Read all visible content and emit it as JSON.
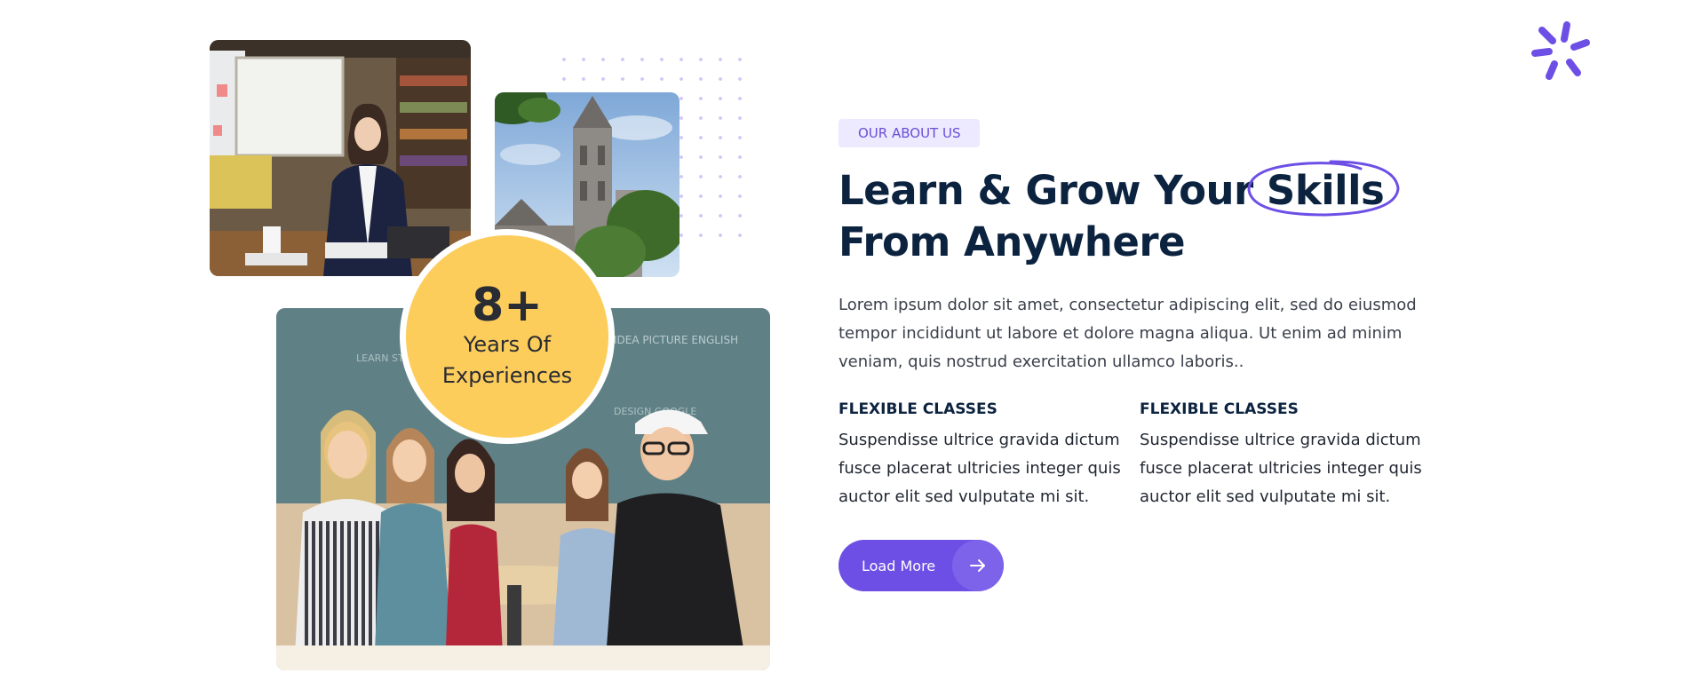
{
  "about": {
    "badge": "OUR ABOUT US",
    "heading_part1": "Learn & Grow Your ",
    "heading_highlight": "Skills",
    "heading_part2": "From Anywhere",
    "description": "Lorem ipsum dolor sit amet, consectetur adipiscing elit, sed do eiusmod tempor incididunt ut labore et dolore magna aliqua. Ut enim ad minim veniam, quis nostrud exercitation ullamco laboris..",
    "features": [
      {
        "title": "FLEXIBLE CLASSES",
        "text": "Suspendisse ultrice gravida dictum fusce placerat ultricies integer quis auctor elit sed vulputate mi sit."
      },
      {
        "title": "FLEXIBLE CLASSES",
        "text": "Suspendisse ultrice gravida dictum fusce placerat ultricies integer quis auctor elit sed vulputate mi sit."
      }
    ],
    "button_label": "Load More"
  },
  "experience": {
    "number": "8+",
    "label_line1": "Years Of",
    "label_line2": "Experiences"
  },
  "icons": {
    "sparkle": "sparkle-icon",
    "button_arrow": "arrow-right-icon"
  },
  "colors": {
    "accent": "#6d4fe6",
    "heading": "#0c2340",
    "badge_bg": "#ede9fe",
    "experience_bg": "#fdcd5c"
  }
}
